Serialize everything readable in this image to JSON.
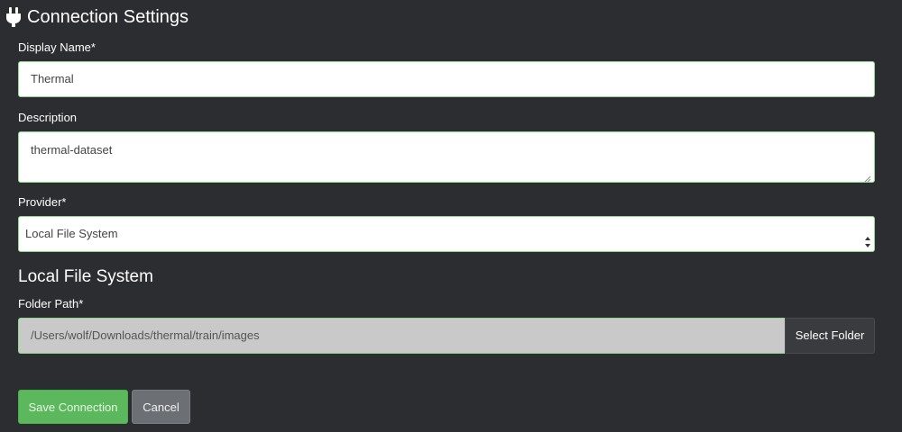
{
  "header": {
    "title": "Connection Settings",
    "icon": "plug-icon"
  },
  "form": {
    "display_name": {
      "label": "Display Name*",
      "value": "Thermal"
    },
    "description": {
      "label": "Description",
      "value": "thermal-dataset"
    },
    "provider": {
      "label": "Provider*",
      "selected": "Local File System"
    }
  },
  "provider_section": {
    "title": "Local File System",
    "folder_path": {
      "label": "Folder Path*",
      "value": "/Users/wolf/Downloads/thermal/train/images"
    },
    "select_folder_label": "Select Folder"
  },
  "actions": {
    "save_label": "Save Connection",
    "cancel_label": "Cancel"
  },
  "colors": {
    "background": "#2c2d31",
    "field_border": "#8fd98f",
    "primary": "#5cb85c",
    "secondary": "#6c6f73"
  }
}
